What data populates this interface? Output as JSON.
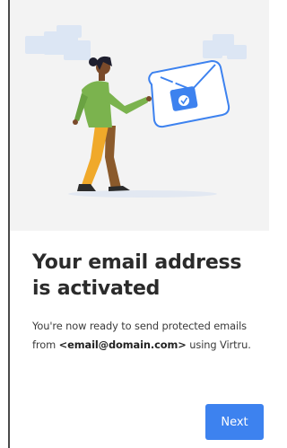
{
  "title_line1": "Your email address",
  "title_line2": "is activated",
  "description": {
    "prefix": "You're now ready to send protected emails from ",
    "email": "<email@domain.com>",
    "suffix": " using Virtru."
  },
  "next_label": "Next",
  "colors": {
    "accent": "#3d82ef",
    "hero_bg": "#f3f3f3",
    "title": "#2b2b2b"
  }
}
